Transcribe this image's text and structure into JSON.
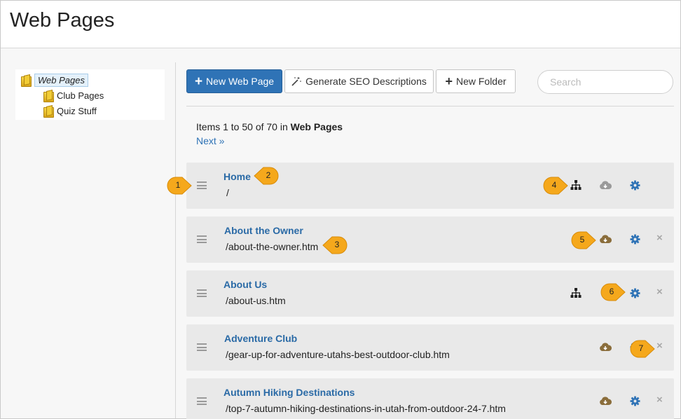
{
  "page": {
    "title": "Web Pages"
  },
  "tree": {
    "root": "Web Pages",
    "children": [
      "Club Pages",
      "Quiz Stuff"
    ]
  },
  "toolbar": {
    "new_page_label": "New Web Page",
    "seo_label": "Generate SEO Descriptions",
    "new_folder_label": "New Folder",
    "search_placeholder": "Search"
  },
  "listing": {
    "items_prefix": "Items 1 to 50 of 70 in ",
    "items_folder": "Web Pages",
    "next_label": "Next »"
  },
  "rows": [
    {
      "title": "Home",
      "url": "/"
    },
    {
      "title": "About the Owner",
      "url": "/about-the-owner.htm"
    },
    {
      "title": "About Us",
      "url": "/about-us.htm"
    },
    {
      "title": "Adventure Club",
      "url": "/gear-up-for-adventure-utahs-best-outdoor-club.htm"
    },
    {
      "title": "Autumn Hiking Destinations",
      "url": "/top-7-autumn-hiking-destinations-in-utah-from-outdoor-24-7.htm"
    }
  ],
  "callouts": [
    "1",
    "2",
    "3",
    "4",
    "5",
    "6",
    "7"
  ],
  "icons": {
    "sitemap": "sitemap-icon",
    "cloud_download": "cloud-download-icon",
    "gear": "gear-icon",
    "close": "close-icon",
    "remove_glyph": "×"
  },
  "colors": {
    "primary": "#2f73b6",
    "link": "#2a6aa6",
    "callout": "#f5a81c",
    "cloud_active": "#8a6d3b",
    "cloud_inactive": "#9a9a9a"
  }
}
